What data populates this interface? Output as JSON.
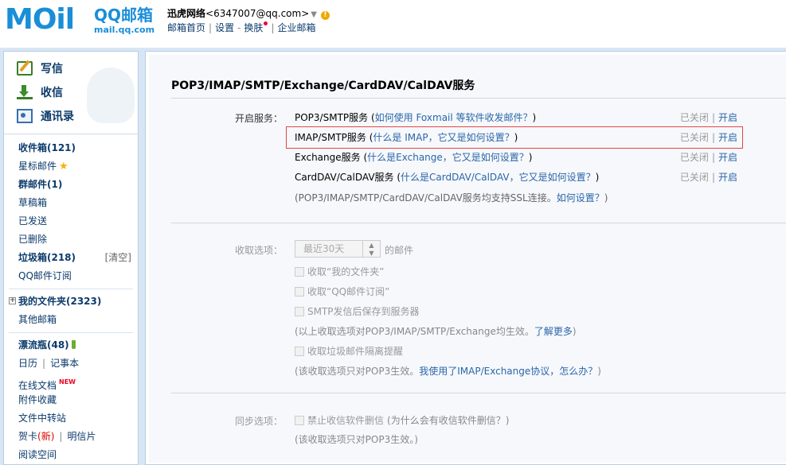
{
  "header": {
    "logo_text": "MOil",
    "brand_title": "QQ邮箱",
    "brand_sub": "mail.qq.com",
    "user_name": "迅虎网络",
    "user_email": "<6347007@qq.com>",
    "links": [
      "邮箱首页",
      "设置",
      "换肤",
      "企业邮箱"
    ]
  },
  "quick": {
    "write": "写信",
    "receive": "收信",
    "contacts": "通讯录"
  },
  "folders": {
    "inbox": "收件箱(121)",
    "starred": "星标邮件",
    "group": "群邮件(1)",
    "drafts": "草稿箱",
    "sent": "已发送",
    "deleted": "已删除",
    "spam": "垃圾箱(218)",
    "spam_clear": "[清空]",
    "subscribe": "QQ邮件订阅",
    "myfolders": "我的文件夹(2323)",
    "other": "其他邮箱",
    "bottle": "漂流瓶(48)",
    "calendar": "日历",
    "notes": "记事本",
    "docs": "在线文档",
    "docs_badge": "NEW",
    "attach": "附件收藏",
    "transfer": "文件中转站",
    "card": "贺卡",
    "card_new": "(新)",
    "postcard": "明信片",
    "reading": "阅读空间"
  },
  "main": {
    "heading": "POP3/IMAP/SMTP/Exchange/CardDAV/CalDAV服务",
    "open_label": "开启服务：",
    "services": [
      {
        "name": "POP3/SMTP服务",
        "open": " (",
        "help": "如何使用 Foxmail 等软件收发邮件？",
        "close": ")"
      },
      {
        "name": "IMAP/SMTP服务",
        "open": " (",
        "help": "什么是 IMAP，它又是如何设置？",
        "close": ")"
      },
      {
        "name": "Exchange服务",
        "open": " (",
        "help": "什么是Exchange，它又是如何设置？",
        "close": ")"
      },
      {
        "name": "CardDAV/CalDAV服务",
        "open": " (",
        "help": "什么是CardDAV/CalDAV，它又是如何设置？",
        "close": ")"
      }
    ],
    "status_off": "已关闭",
    "status_sep": "|",
    "status_on": "开启",
    "ssl_note_text": "(POP3/IMAP/SMTP/CardDAV/CalDAV服务均支持SSL连接。",
    "ssl_note_link": "如何设置？",
    "ssl_note_end": ")",
    "receive_label": "收取选项：",
    "receive_select": "最近30天",
    "receive_suffix": "的邮件",
    "cb1": "收取“我的文件夹”",
    "cb2": "收取“QQ邮件订阅”",
    "cb3": "SMTP发信后保存到服务器",
    "note1_text": "(以上收取选项对POP3/IMAP/SMTP/Exchange均生效。",
    "note1_link": "了解更多",
    "note1_end": ")",
    "cb4": "收取垃圾邮件隔离提醒",
    "note2_text": "(该收取选项只对POP3生效。",
    "note2_link": "我使用了IMAP/Exchange协议，怎么办？",
    "note2_end": ")",
    "sync_label": "同步选项：",
    "cb5": "禁止收信软件删信",
    "cb5_help": "(为什么会有收信软件删信？)",
    "note3": "(该收取选项只对POP3生效。)"
  }
}
